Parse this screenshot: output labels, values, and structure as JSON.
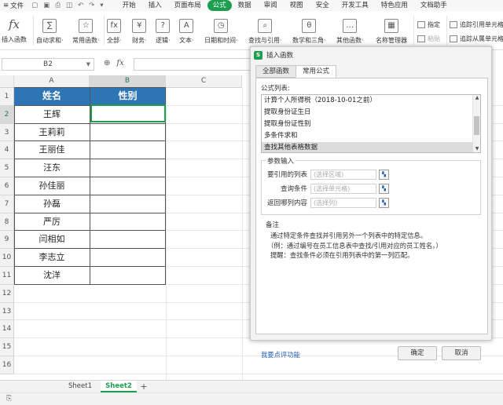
{
  "menubar": {
    "file": "文件",
    "tabs": [
      "开始",
      "插入",
      "页面布局",
      "公式",
      "数据",
      "审阅",
      "视图",
      "安全",
      "开发工具",
      "特色应用",
      "文档助手"
    ],
    "active_tab": "公式"
  },
  "ribbon": {
    "buttons": [
      {
        "label": "插入函数",
        "icon": "fx-icon",
        "glyph": "fx"
      },
      {
        "label": "自动求和·",
        "icon": "sum-icon",
        "glyph": "∑"
      },
      {
        "label": "常用函数·",
        "icon": "star-function-icon",
        "glyph": "☆"
      },
      {
        "label": "全部·",
        "icon": "all-function-icon",
        "glyph": "fx"
      },
      {
        "label": "财务·",
        "icon": "finance-icon",
        "glyph": "¥"
      },
      {
        "label": "逻辑·",
        "icon": "logic-icon",
        "glyph": "?"
      },
      {
        "label": "文本·",
        "icon": "text-icon",
        "glyph": "A"
      },
      {
        "label": "日期和时间·",
        "icon": "datetime-icon",
        "glyph": "◷"
      },
      {
        "label": "查找与引用·",
        "icon": "lookup-icon",
        "glyph": "⌕"
      },
      {
        "label": "数学和三角·",
        "icon": "math-icon",
        "glyph": "θ"
      },
      {
        "label": "其他函数·",
        "icon": "other-function-icon",
        "glyph": "…"
      },
      {
        "label": "名称管理器",
        "icon": "name-manager-icon",
        "glyph": "▦"
      }
    ],
    "small": {
      "define": "指定",
      "paste": "粘贴",
      "trace_precedents": "追踪引用单元格",
      "trace_dependents": "追踪从属单元格"
    }
  },
  "formula_bar": {
    "name_box": "B2",
    "fx": "fx"
  },
  "columns": [
    "A",
    "B",
    "C"
  ],
  "rows": [
    "1",
    "2",
    "3",
    "4",
    "5",
    "6",
    "7",
    "8",
    "9",
    "10",
    "11",
    "12",
    "13",
    "14",
    "15",
    "16"
  ],
  "table": {
    "headers": [
      "姓名",
      "性别"
    ],
    "names": [
      "王辉",
      "王莉莉",
      "王丽佳",
      "汪东",
      "孙佳丽",
      "孙磊",
      "严厉",
      "闫相如",
      "李志立",
      "沈洋"
    ]
  },
  "sheets": {
    "tabs": [
      "Sheet1",
      "Sheet2"
    ],
    "active": "Sheet2",
    "add": "+"
  },
  "dialog": {
    "title": "插入函数",
    "tabs": [
      "全部函数",
      "常用公式"
    ],
    "active_tab": "常用公式",
    "list_label": "公式列表:",
    "items": [
      "计算个人所得税（2018-10-01之前）",
      "提取身份证生日",
      "提取身份证性别",
      "多条件求和",
      "查找其他表格数据"
    ],
    "selected_item": "查找其他表格数据",
    "params_label": "参数输入",
    "params": [
      {
        "label": "要引用的列表",
        "placeholder": "(选择区域)"
      },
      {
        "label": "查询条件",
        "placeholder": "(选择单元格)"
      },
      {
        "label": "返回哪列内容",
        "placeholder": "(选择列)"
      }
    ],
    "note_title": "备注",
    "note_lines": [
      "通过特定条件查找并引用另外一个列表中的特定信息。",
      "（例：通过编号在员工信息表中查找/引用对应的员工姓名。）",
      "提醒：查找条件必须在引用列表中的第一列匹配。"
    ],
    "link": "我要点评功能",
    "ok": "确定",
    "cancel": "取消"
  },
  "colors": {
    "accent": "#1e9e4f",
    "header_fill": "#2e75b6",
    "link": "#2b5fb4"
  }
}
